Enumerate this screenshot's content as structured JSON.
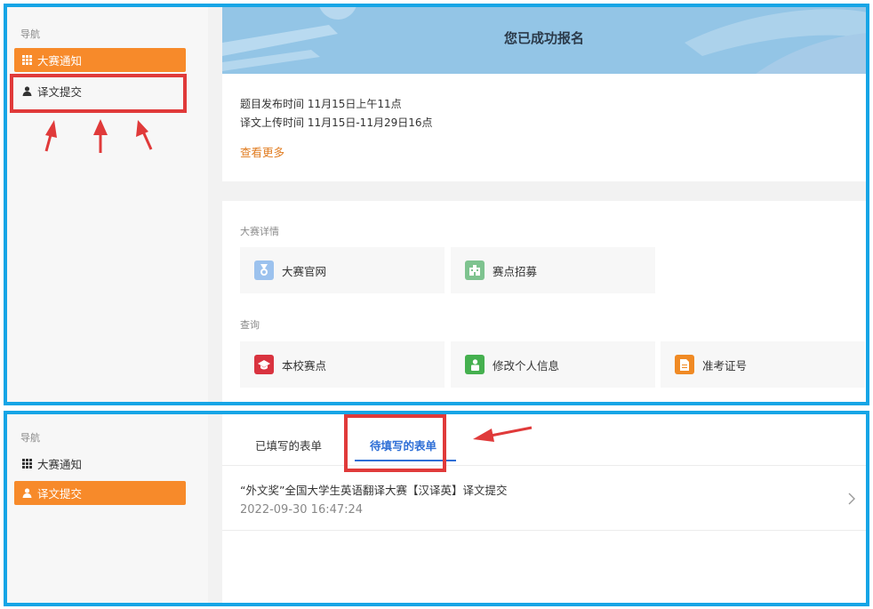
{
  "colors": {
    "frame": "#16a5e6",
    "accent": "#f78a2a",
    "highlight_box": "#e03a3a",
    "tab_active": "#2f6fd6",
    "banner": "#93c5e6"
  },
  "top": {
    "sidebar": {
      "title": "导航",
      "items": [
        {
          "label": "大赛通知",
          "icon": "grid-icon",
          "active": true
        },
        {
          "label": "译文提交",
          "icon": "user-icon",
          "active": false
        }
      ]
    },
    "banner": {
      "title": "您已成功报名"
    },
    "info": {
      "line1": "题目发布时间 11月15日上午11点",
      "line2": "译文上传时间 11月15日-11月29日16点",
      "more": "查看更多"
    },
    "details": {
      "section1_label": "大赛详情",
      "section1_tiles": [
        {
          "label": "大赛官网",
          "icon": "medal-icon",
          "color": "#9cc2ee"
        },
        {
          "label": "赛点招募",
          "icon": "building-icon",
          "color": "#7ec38f"
        }
      ],
      "section2_label": "查询",
      "section2_tiles": [
        {
          "label": "本校赛点",
          "icon": "graduation-cap-icon",
          "color": "#d9333f"
        },
        {
          "label": "修改个人信息",
          "icon": "person-icon",
          "color": "#45b04f"
        },
        {
          "label": "准考证号",
          "icon": "document-icon",
          "color": "#f08a24"
        }
      ]
    }
  },
  "bottom": {
    "sidebar": {
      "title": "导航",
      "items": [
        {
          "label": "大赛通知",
          "icon": "grid-icon",
          "active": false
        },
        {
          "label": "译文提交",
          "icon": "user-icon",
          "active": true
        }
      ]
    },
    "tabs": [
      {
        "label": "已填写的表单",
        "active": false
      },
      {
        "label": "待填写的表单",
        "active": true
      }
    ],
    "list": [
      {
        "title": "“外文奖”全国大学生英语翻译大赛【汉译英】译文提交",
        "time": "2022-09-30 16:47:24"
      }
    ]
  }
}
